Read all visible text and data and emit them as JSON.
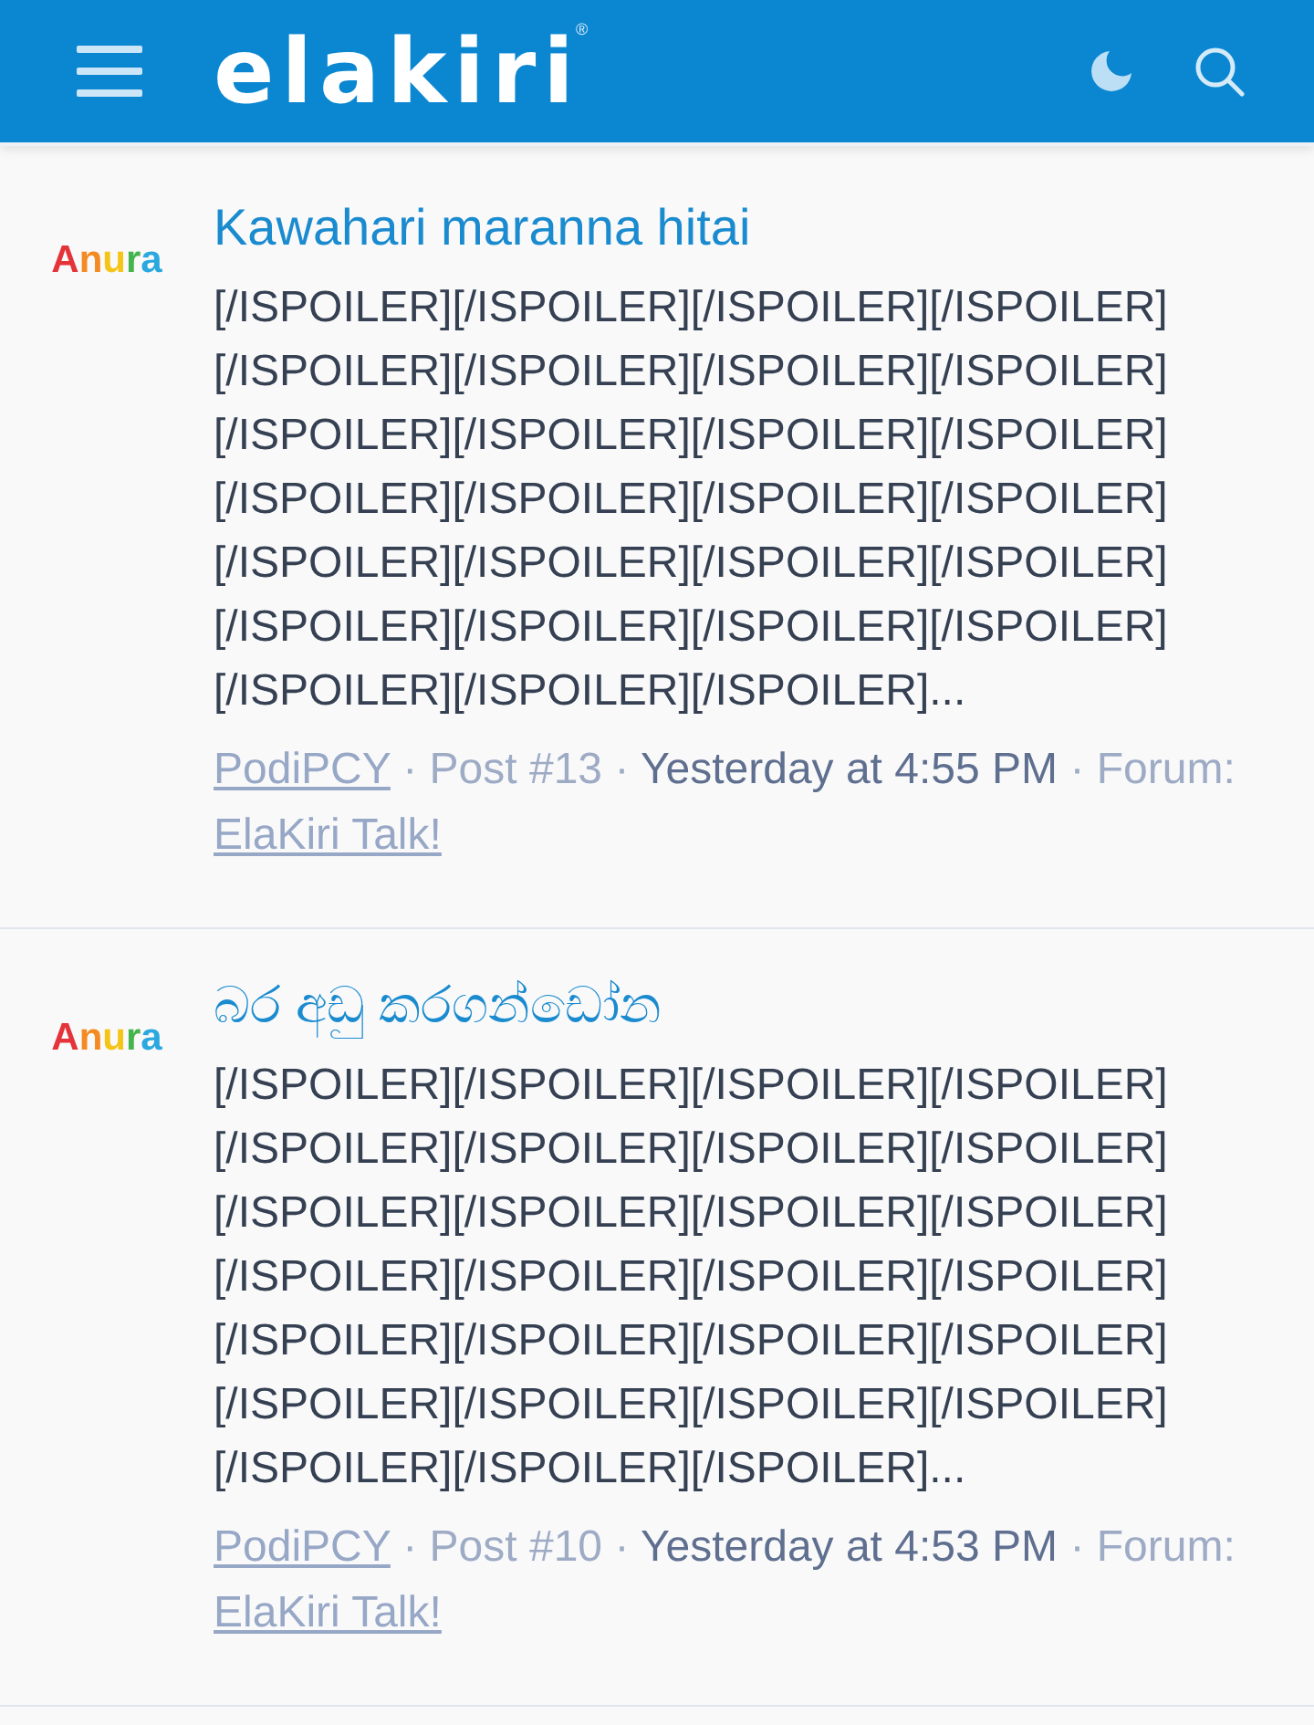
{
  "header": {
    "logo": "elakiri",
    "logo_mark": "®"
  },
  "posts": [
    {
      "avatar": {
        "text": "Anura"
      },
      "title": "Kawahari maranna hitai",
      "snippet": "[/ISPOILER][/ISPOILER][/ISPOILER][/ISPOILER][/ISPOILER][/ISPOILER][/ISPOILER][/ISPOILER][/ISPOILER][/ISPOILER][/ISPOILER][/ISPOILER][/ISPOILER][/ISPOILER][/ISPOILER][/ISPOILER][/ISPOILER][/ISPOILER][/ISPOILER][/ISPOILER][/ISPOILER][/ISPOILER][/ISPOILER][/ISPOILER][/ISPOILER][/ISPOILER][/ISPOILER]...",
      "meta": [
        {
          "kind": "author",
          "text": "PodiPCY"
        },
        {
          "kind": "separator",
          "text": "·"
        },
        {
          "kind": "post_number",
          "text": "Post #13"
        },
        {
          "kind": "separator",
          "text": "·"
        },
        {
          "kind": "time",
          "text": "Yesterday at 4:55 PM"
        },
        {
          "kind": "separator",
          "text": "·"
        },
        {
          "kind": "label",
          "text": "Forum:"
        },
        {
          "kind": "forum",
          "text": "ElaKiri Talk!"
        }
      ]
    },
    {
      "avatar": {
        "text": "Anura"
      },
      "title": "බර අඩු කරගන්ඩෝන",
      "snippet": "[/ISPOILER][/ISPOILER][/ISPOILER][/ISPOILER][/ISPOILER][/ISPOILER][/ISPOILER][/ISPOILER][/ISPOILER][/ISPOILER][/ISPOILER][/ISPOILER][/ISPOILER][/ISPOILER][/ISPOILER][/ISPOILER][/ISPOILER][/ISPOILER][/ISPOILER][/ISPOILER][/ISPOILER][/ISPOILER][/ISPOILER][/ISPOILER][/ISPOILER][/ISPOILER][/ISPOILER]...",
      "meta": [
        {
          "kind": "author",
          "text": "PodiPCY"
        },
        {
          "kind": "separator",
          "text": "·"
        },
        {
          "kind": "post_number",
          "text": "Post #10"
        },
        {
          "kind": "separator",
          "text": "·"
        },
        {
          "kind": "time",
          "text": "Yesterday at 4:53 PM"
        },
        {
          "kind": "separator",
          "text": "·"
        },
        {
          "kind": "label",
          "text": "Forum:"
        },
        {
          "kind": "forum",
          "text": "ElaKiri Talk!"
        }
      ]
    }
  ]
}
